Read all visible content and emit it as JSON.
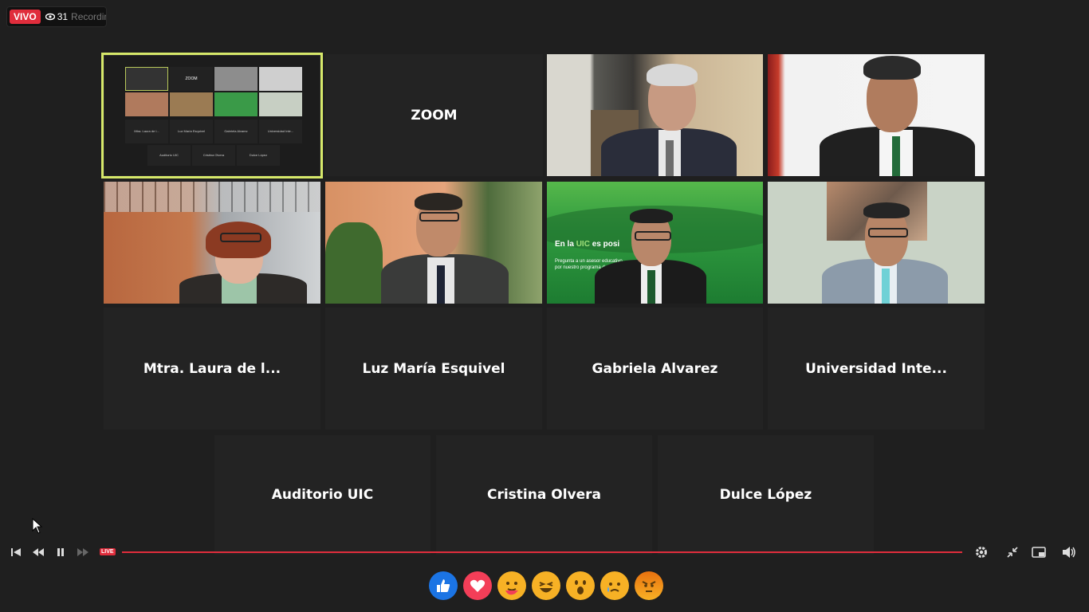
{
  "live": {
    "badge": "VIVO",
    "viewers": "31",
    "title": "Recording..."
  },
  "tiles": {
    "zoom_label": "ZOOM",
    "names_row": [
      "Mtra. Laura de l...",
      "Luz María Esquivel",
      "Gabriela Alvarez",
      "Universidad  Inte..."
    ],
    "names_bottom": [
      "Auditorio UIC",
      "Cristina Olvera",
      "Dulce López"
    ]
  },
  "thumbnail": {
    "zoom_label": "ZOOM",
    "names_row": [
      "Mtra. Laura de l...",
      "Luz María Esquivel",
      "Gabriela Alvarez",
      "Universidad Inte..."
    ],
    "names_bottom": [
      "Auditorio UIC",
      "Cristina Olvera",
      "Dulce López"
    ]
  },
  "banner": {
    "prefix": "En la ",
    "brand": "UIC",
    "suffix": " es posi",
    "line1": "Pregunta a un asesor educativo",
    "line2": "por nuestro programa de b"
  },
  "player": {
    "live_tag": "LIVE",
    "progress": 1.0
  },
  "reactions": [
    "like-reaction",
    "love-reaction",
    "care-reaction",
    "haha-reaction",
    "wow-reaction",
    "sad-reaction",
    "angry-reaction"
  ],
  "colors": {
    "accent_red": "#e02d3c",
    "active_border": "#d6e86a",
    "uic_green": "#2d9a3e"
  }
}
